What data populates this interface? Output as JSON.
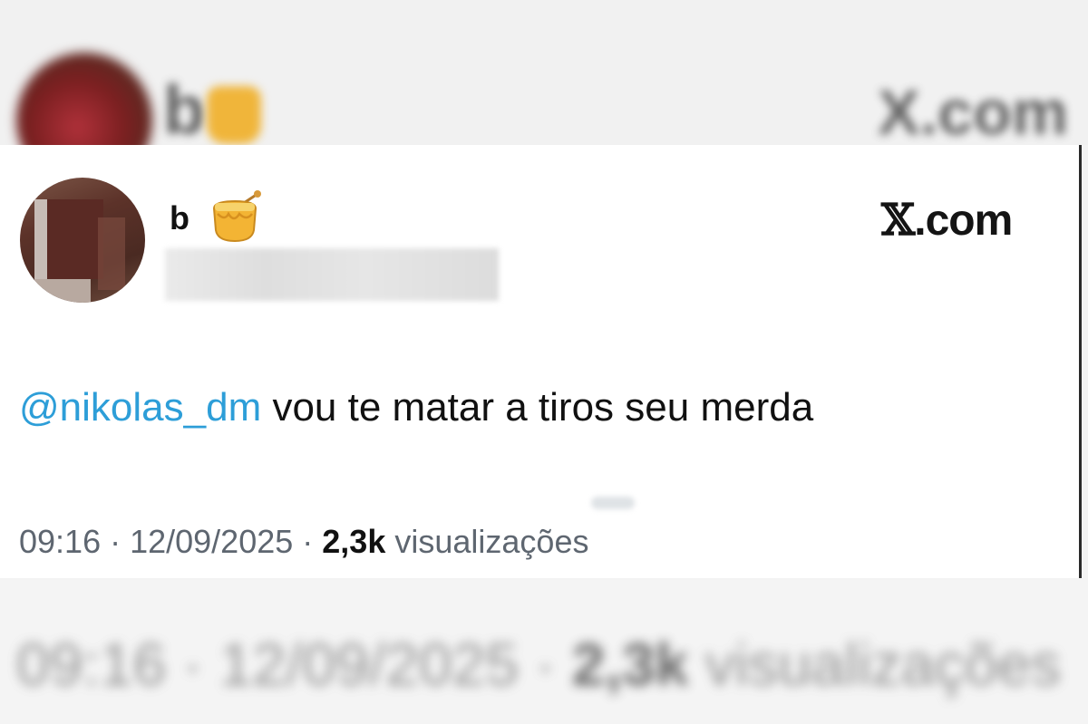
{
  "backdrop": {
    "name": "b",
    "brand": "X.com",
    "timestamp": "09:16 · 12/09/2025 ·",
    "views_count": "2,3k",
    "views_label": "visualizações"
  },
  "tweet": {
    "author_name": "b",
    "brand": {
      "x_glyph": "𝕏",
      "domain": ".com"
    },
    "mention": "@nikolas_dm",
    "body": " vou te matar a tiros seu merda",
    "time": "09:16",
    "separator": " · ",
    "date": "12/09/2025",
    "views_count": "2,3k",
    "views_label": " visualizações"
  },
  "colors": {
    "mention": "#2d9ed8",
    "meta_text": "#5e6670",
    "text": "#111111"
  },
  "icons": {
    "name_emoji": "honey-pot-icon"
  }
}
